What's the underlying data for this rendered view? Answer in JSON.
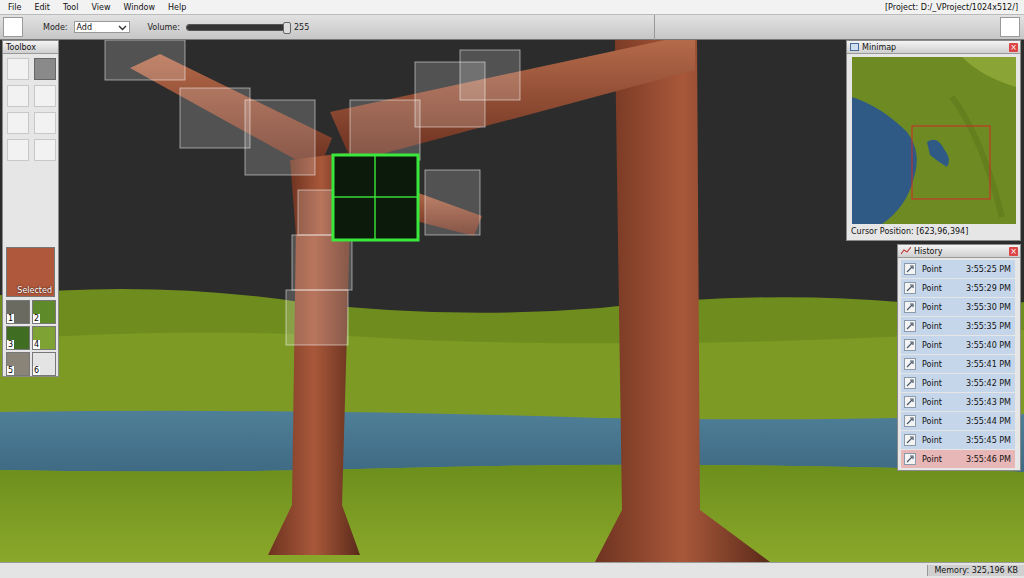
{
  "menu": [
    "File",
    "Edit",
    "Tool",
    "View",
    "Window",
    "Help"
  ],
  "window": {
    "project": "[Project: D:/_VProject/1024x512/]"
  },
  "toolbar": {
    "mode_label": "Mode:",
    "mode": "Add",
    "volume_label": "Volume:",
    "volume_level": 1.0,
    "volume": "255"
  },
  "toolbox": {
    "title": "Toolbox",
    "tools": [
      {
        "selected": false
      },
      {
        "selected": true
      },
      {
        "selected": false
      },
      {
        "selected": false
      },
      {
        "selected": false
      },
      {
        "selected": false
      },
      {
        "selected": false
      },
      {
        "selected": false
      }
    ],
    "current_material": {
      "label": "Selected",
      "color": "#b0583c"
    },
    "materials": [
      {
        "label": "1",
        "color": "#6b6a60",
        "selected": false
      },
      {
        "label": "2",
        "color": "#5e8a2a",
        "selected": false
      },
      {
        "label": "3",
        "color": "#3f6e22",
        "selected": false
      },
      {
        "label": "4",
        "color": "#7fa234",
        "selected": false
      },
      {
        "label": "5",
        "color": "#8a8478",
        "selected": false
      },
      {
        "label": "6",
        "color": "#e4e4e4",
        "selected": false
      }
    ]
  },
  "minimap": {
    "title": "Minimap",
    "close": "×",
    "cursor_position": "Cursor Position: [623,96,394]"
  },
  "history": {
    "title": "History",
    "close": "×",
    "items": [
      {
        "label": "Point",
        "time": "3:55:25 PM",
        "selected": false
      },
      {
        "label": "Point",
        "time": "3:55:29 PM",
        "selected": false
      },
      {
        "label": "Point",
        "time": "3:55:30 PM",
        "selected": false
      },
      {
        "label": "Point",
        "time": "3:55:35 PM",
        "selected": false
      },
      {
        "label": "Point",
        "time": "3:55:40 PM",
        "selected": false
      },
      {
        "label": "Point",
        "time": "3:55:41 PM",
        "selected": false
      },
      {
        "label": "Point",
        "time": "3:55:42 PM",
        "selected": false
      },
      {
        "label": "Point",
        "time": "3:55:43 PM",
        "selected": false
      },
      {
        "label": "Point",
        "time": "3:55:44 PM",
        "selected": false
      },
      {
        "label": "Point",
        "time": "3:55:45 PM",
        "selected": false
      },
      {
        "label": "Point",
        "time": "3:55:46 PM",
        "selected": true
      }
    ]
  },
  "status_bar": {
    "memory": "Memory: 325,196 KB"
  }
}
